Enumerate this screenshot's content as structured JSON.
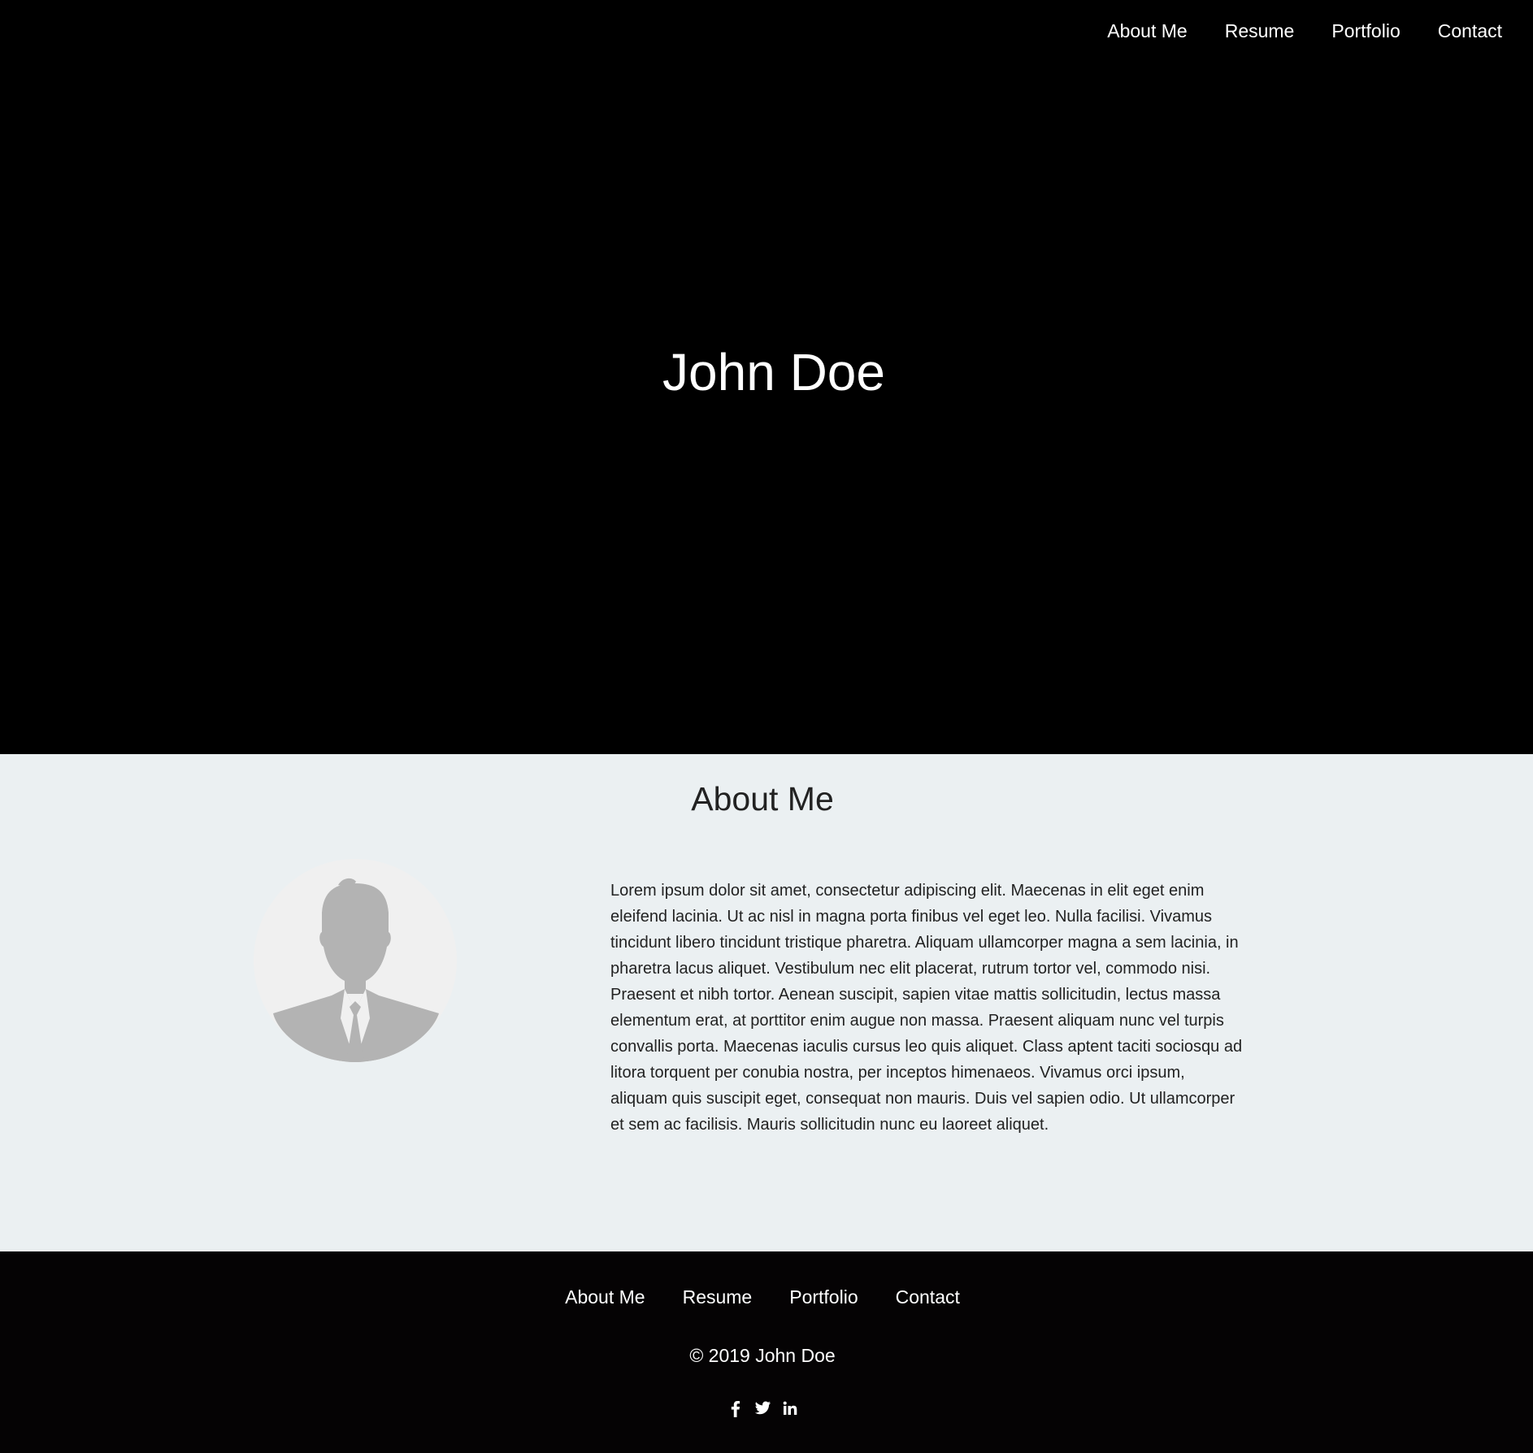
{
  "nav": {
    "items": [
      {
        "label": "About Me"
      },
      {
        "label": "Resume"
      },
      {
        "label": "Portfolio"
      },
      {
        "label": "Contact"
      }
    ]
  },
  "hero": {
    "title": "John Doe"
  },
  "about": {
    "heading": "About Me",
    "avatar_icon": "person-silhouette-icon",
    "text": "Lorem ipsum dolor sit amet, consectetur adipiscing elit. Maecenas in elit eget enim eleifend lacinia. Ut ac nisl in magna porta finibus vel eget leo. Nulla facilisi. Vivamus tincidunt libero tincidunt tristique pharetra. Aliquam ullamcorper magna a sem lacinia, in pharetra lacus aliquet. Vestibulum nec elit placerat, rutrum tortor vel, commodo nisi. Praesent et nibh tortor. Aenean suscipit, sapien vitae mattis sollicitudin, lectus massa elementum erat, at porttitor enim augue non massa. Praesent aliquam nunc vel turpis convallis porta. Maecenas iaculis cursus leo quis aliquet. Class aptent taciti sociosqu ad litora torquent per conubia nostra, per inceptos himenaeos. Vivamus orci ipsum, aliquam quis suscipit eget, consequat non mauris. Duis vel sapien odio. Ut ullamcorper et sem ac facilisis. Mauris sollicitudin nunc eu laoreet aliquet."
  },
  "footer": {
    "nav": [
      {
        "label": "About Me"
      },
      {
        "label": "Resume"
      },
      {
        "label": "Portfolio"
      },
      {
        "label": "Contact"
      }
    ],
    "copyright": "© 2019 John Doe",
    "social": [
      {
        "icon": "facebook-icon"
      },
      {
        "icon": "twitter-icon"
      },
      {
        "icon": "linkedin-icon"
      }
    ]
  },
  "colors": {
    "hero_bg": "#000000",
    "about_bg": "#ebf0f2",
    "footer_bg": "#050304",
    "avatar_bg": "#f0f0f0",
    "avatar_fg": "#b3b3b3"
  }
}
